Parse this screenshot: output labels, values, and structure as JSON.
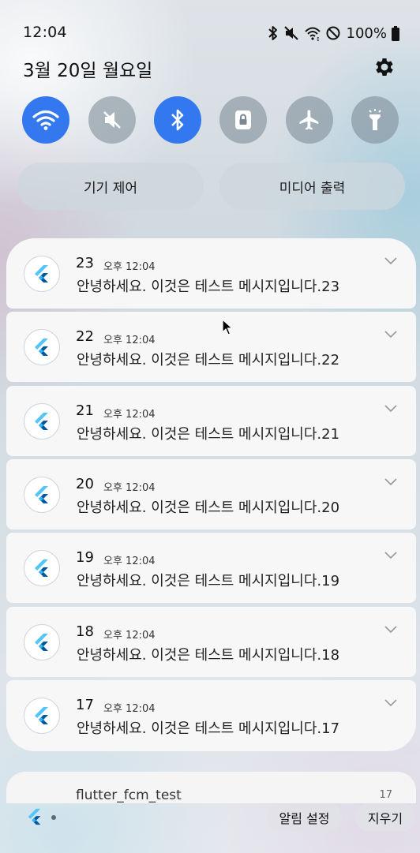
{
  "status_bar": {
    "time": "12:04",
    "battery_percent": "100%",
    "icons": [
      "bluetooth-icon",
      "mute-icon",
      "wifi-icon",
      "do-not-disturb-icon",
      "battery-icon"
    ]
  },
  "header": {
    "date": "3월 20일 월요일",
    "settings_icon": "gear-icon"
  },
  "quick_toggles": [
    {
      "name": "wifi",
      "icon": "wifi-icon",
      "state": "on"
    },
    {
      "name": "sound",
      "icon": "mute-icon",
      "state": "off"
    },
    {
      "name": "bluetooth",
      "icon": "bluetooth-icon",
      "state": "on"
    },
    {
      "name": "screen-lock",
      "icon": "lock-icon",
      "state": "off"
    },
    {
      "name": "airplane-mode",
      "icon": "airplane-icon",
      "state": "off"
    },
    {
      "name": "flashlight",
      "icon": "flashlight-icon",
      "state": "off"
    }
  ],
  "pills": {
    "device_control": "기기 제어",
    "media_output": "미디어 출력"
  },
  "notifications": [
    {
      "title": "23",
      "time": "오후 12:04",
      "body": "안녕하세요. 이것은 테스트 메시지입니다.23"
    },
    {
      "title": "22",
      "time": "오후 12:04",
      "body": "안녕하세요. 이것은 테스트 메시지입니다.22"
    },
    {
      "title": "21",
      "time": "오후 12:04",
      "body": "안녕하세요. 이것은 테스트 메시지입니다.21"
    },
    {
      "title": "20",
      "time": "오후 12:04",
      "body": "안녕하세요. 이것은 테스트 메시지입니다.20"
    },
    {
      "title": "19",
      "time": "오후 12:04",
      "body": "안녕하세요. 이것은 테스트 메시지입니다.19"
    },
    {
      "title": "18",
      "time": "오후 12:04",
      "body": "안녕하세요. 이것은 테스트 메시지입니다.18"
    },
    {
      "title": "17",
      "time": "오후 12:04",
      "body": "안녕하세요. 이것은 테스트 메시지입니다.17"
    }
  ],
  "next_card": {
    "title": "flutter_fcm_test",
    "meta": "17"
  },
  "bottom_bar": {
    "notification_settings": "알림 설정",
    "clear": "지우기"
  },
  "colors": {
    "accent": "#3478f0",
    "toggle_off": "#7b8791",
    "card": "#f7f7f8"
  }
}
